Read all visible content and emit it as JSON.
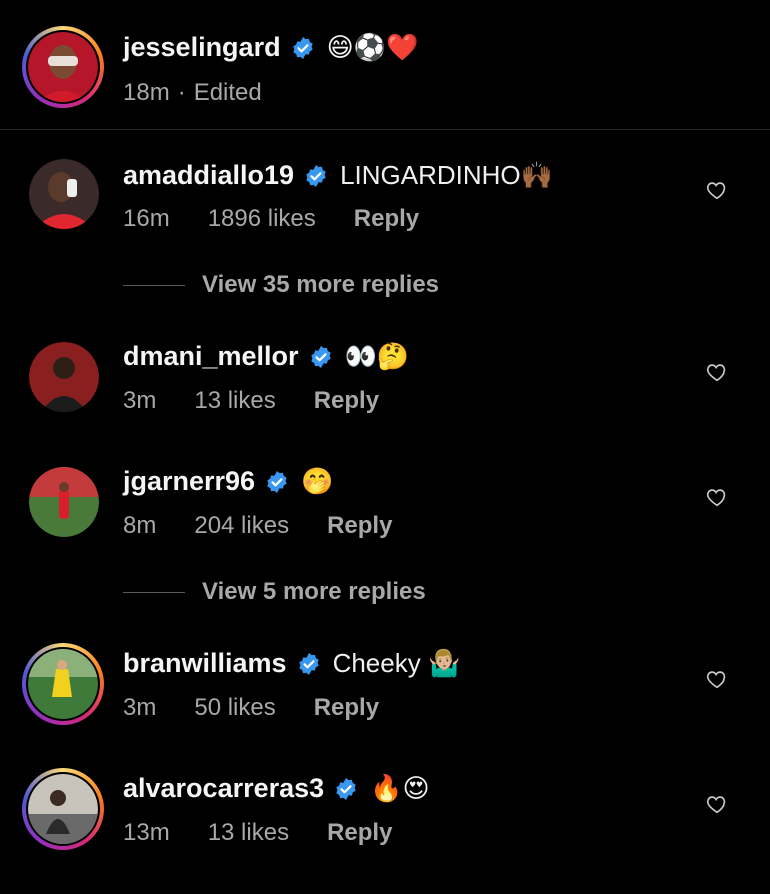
{
  "post": {
    "username": "jesselingard",
    "emojis": "😄⚽❤️",
    "time": "18m",
    "edited": "Edited",
    "separator": "·"
  },
  "comments": [
    {
      "username": "amaddiallo19",
      "text": "LINGARDINHO🙌🏾",
      "time": "16m",
      "likes": "1896 likes",
      "reply": "Reply"
    },
    {
      "username": "dmani_mellor",
      "text": "👀🤔",
      "time": "3m",
      "likes": "13 likes",
      "reply": "Reply"
    },
    {
      "username": "jgarnerr96",
      "text": "🤭",
      "time": "8m",
      "likes": "204 likes",
      "reply": "Reply"
    },
    {
      "username": "branwilliams",
      "text": "Cheeky 🤷🏼‍♂️",
      "time": "3m",
      "likes": "50 likes",
      "reply": "Reply"
    },
    {
      "username": "alvarocarreras3",
      "text": "🔥😍",
      "time": "13m",
      "likes": "13 likes",
      "reply": "Reply"
    }
  ],
  "view_replies": [
    {
      "label": "View 35 more replies"
    },
    {
      "label": "View 5 more replies"
    }
  ],
  "icons": {
    "verified": "verified-badge-icon",
    "like": "heart-icon"
  },
  "colors": {
    "background": "#000000",
    "verified": "#3897f0",
    "muted": "#a8a8a8"
  }
}
